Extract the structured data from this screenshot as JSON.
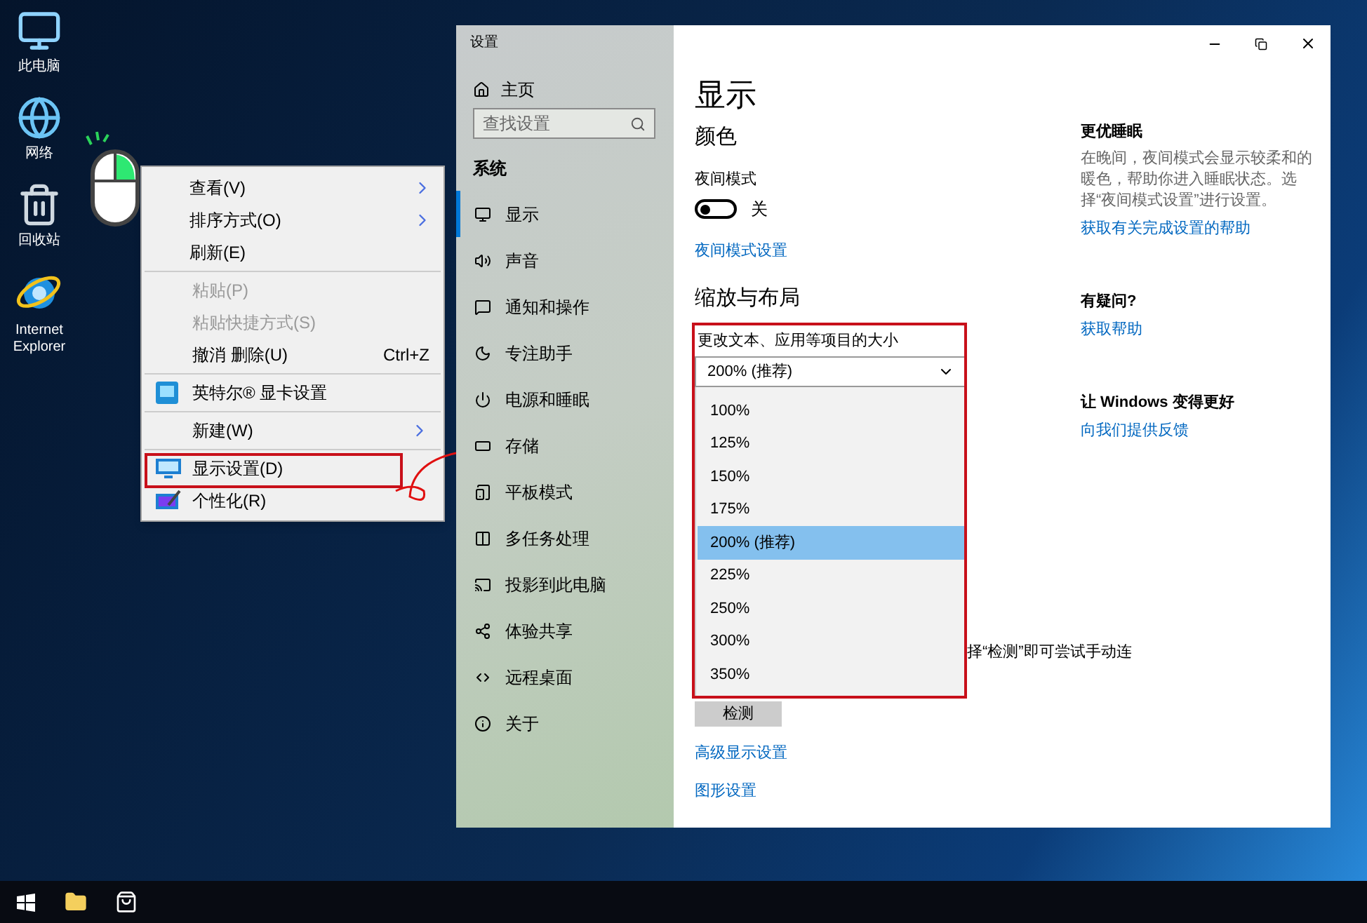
{
  "desktop_icons": [
    {
      "label": "此电脑"
    },
    {
      "label": "网络"
    },
    {
      "label": "回收站"
    },
    {
      "label": "Internet Explorer"
    }
  ],
  "context_menu": {
    "groups": [
      [
        {
          "label": "查看(V)",
          "submenu": true,
          "disabled": false
        },
        {
          "label": "排序方式(O)",
          "submenu": true,
          "disabled": false
        },
        {
          "label": "刷新(E)",
          "submenu": false,
          "disabled": false
        }
      ],
      [
        {
          "label": "粘贴(P)",
          "submenu": false,
          "disabled": true
        },
        {
          "label": "粘贴快捷方式(S)",
          "submenu": false,
          "disabled": true
        },
        {
          "label": "撤消 删除(U)",
          "shortcut": "Ctrl+Z",
          "submenu": false,
          "disabled": false
        }
      ],
      [
        {
          "label": "英特尔® 显卡设置",
          "submenu": false,
          "disabled": false
        }
      ],
      [
        {
          "label": "新建(W)",
          "submenu": true,
          "disabled": false
        }
      ],
      [
        {
          "label": "显示设置(D)",
          "submenu": false,
          "disabled": false,
          "highlighted": true
        },
        {
          "label": "个性化(R)",
          "submenu": false,
          "disabled": false
        }
      ]
    ]
  },
  "settings_window": {
    "title": "设置",
    "sidebar": {
      "home": "主页",
      "search": {
        "placeholder": "查找设置"
      },
      "section": "系统",
      "items": [
        {
          "label": "显示",
          "selected": true
        },
        {
          "label": "声音",
          "selected": false
        },
        {
          "label": "通知和操作",
          "selected": false
        },
        {
          "label": "专注助手",
          "selected": false
        },
        {
          "label": "电源和睡眠",
          "selected": false
        },
        {
          "label": "存储",
          "selected": false
        },
        {
          "label": "平板模式",
          "selected": false
        },
        {
          "label": "多任务处理",
          "selected": false
        },
        {
          "label": "投影到此电脑",
          "selected": false
        },
        {
          "label": "体验共享",
          "selected": false
        },
        {
          "label": "远程桌面",
          "selected": false
        },
        {
          "label": "关于",
          "selected": false
        }
      ]
    },
    "page_title": "显示",
    "color_section": {
      "heading": "颜色",
      "night_light": {
        "label": "夜间模式",
        "on": false,
        "state_text": "关"
      },
      "link": "夜间模式设置"
    },
    "scale_section": {
      "heading": "缩放与布局",
      "size_label": "更改文本、应用等项目的大小",
      "value": "200% (推荐)",
      "options": [
        {
          "label": "100%",
          "selected": false
        },
        {
          "label": "125%",
          "selected": false
        },
        {
          "label": "150%",
          "selected": false
        },
        {
          "label": "175%",
          "selected": false
        },
        {
          "label": "200% (推荐)",
          "selected": true
        },
        {
          "label": "225%",
          "selected": false
        },
        {
          "label": "250%",
          "selected": false
        },
        {
          "label": "300%",
          "selected": false
        },
        {
          "label": "350%",
          "selected": false
        }
      ]
    },
    "detect_text": "择“检测”即可尝试手动连",
    "detect_button": "检测",
    "links": [
      "高级显示设置",
      "图形设置"
    ],
    "side_panel": [
      {
        "heading": "更优睡眠",
        "text": "在晚间，夜间模式会显示较柔和的暖色，帮助你进入睡眠状态。选择“夜间模式设置”进行设置。",
        "link": "获取有关完成设置的帮助"
      },
      {
        "heading": "有疑问?",
        "link": "获取帮助"
      },
      {
        "heading": "让 Windows 变得更好",
        "link": "向我们提供反馈"
      }
    ]
  }
}
